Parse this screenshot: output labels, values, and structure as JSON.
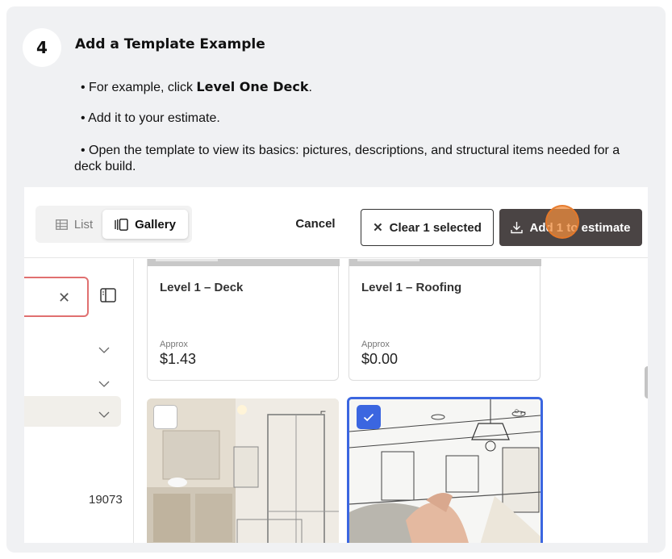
{
  "step": {
    "number": "4",
    "title": "Add a Template Example"
  },
  "instructions": {
    "b1_prefix": "• For example, click ",
    "b1_bold": "Level One Deck",
    "b1_suffix": ".",
    "b2": "• Add it to your estimate.",
    "b3_line1": "• Open the template to view its basics: pictures, descriptions, and structural items needed for a",
    "b3_line2": "deck build."
  },
  "toolbar": {
    "view_list_label": "List",
    "view_gallery_label": "Gallery",
    "cancel_label": "Cancel",
    "clear_label": "Clear 1 selected",
    "add_label": "Add 1 to estimate"
  },
  "sidebar": {
    "result_count": "19073"
  },
  "templates": [
    {
      "title": "Level 1 – Deck",
      "approx_label": "Approx",
      "price": "$1.43"
    },
    {
      "title": "Level 1 – Roofing",
      "approx_label": "Approx",
      "price": "$0.00"
    }
  ],
  "gallery": [
    {
      "checked": false
    },
    {
      "checked": true
    }
  ],
  "colors": {
    "accent_blue": "#3b66e0",
    "primary_button": "#4a4444",
    "search_border": "#e07070",
    "click_marker": "#f08c3c"
  }
}
